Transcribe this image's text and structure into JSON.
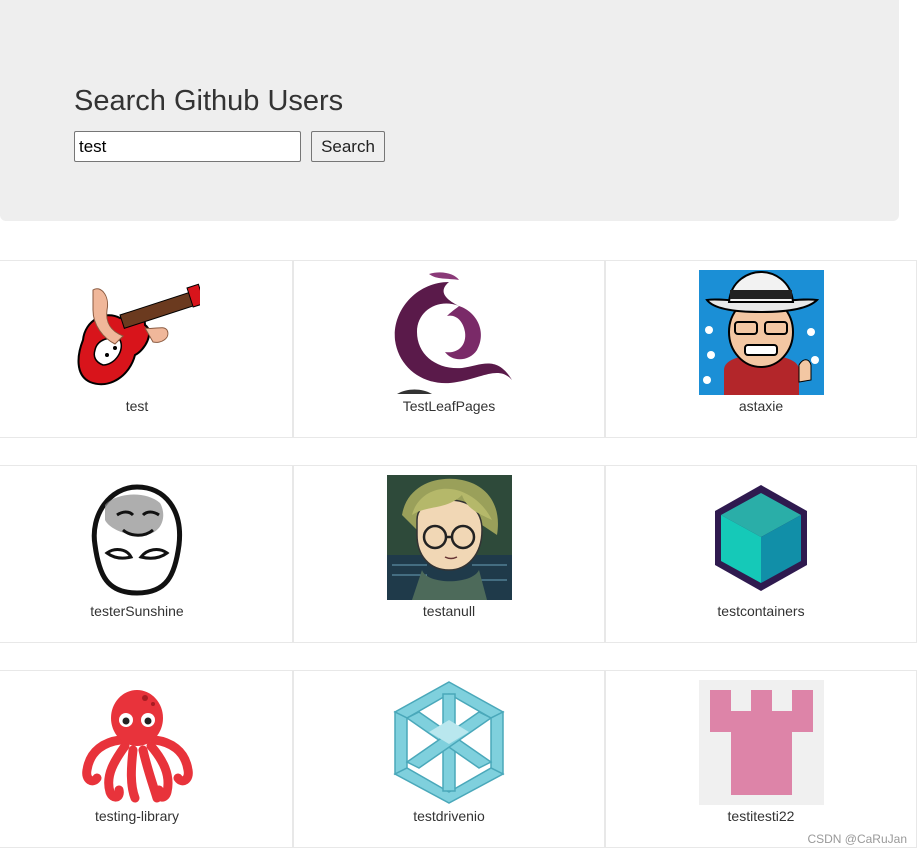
{
  "header": {
    "title": "Search Github Users",
    "search_value": "test",
    "search_button_label": "Search"
  },
  "users": [
    {
      "login": "test",
      "avatar_icon": "guitar-avatar-icon"
    },
    {
      "login": "TestLeafPages",
      "avatar_icon": "swirl-logo-avatar-icon"
    },
    {
      "login": "astaxie",
      "avatar_icon": "cartoon-cowboy-avatar-icon"
    },
    {
      "login": "testerSunshine",
      "avatar_icon": "meme-face-avatar-icon"
    },
    {
      "login": "testanull",
      "avatar_icon": "anime-character-avatar-icon"
    },
    {
      "login": "testcontainers",
      "avatar_icon": "teal-cube-avatar-icon"
    },
    {
      "login": "testing-library",
      "avatar_icon": "red-octopus-avatar-icon"
    },
    {
      "login": "testdrivenio",
      "avatar_icon": "impossible-cube-avatar-icon"
    },
    {
      "login": "testitesti22",
      "avatar_icon": "pink-identicon-avatar-icon"
    }
  ],
  "watermark": "CSDN @CaRuJan",
  "colors": {
    "jumbotron_bg": "#eeeeee",
    "card_border": "#e8e8e8",
    "text": "#333333"
  }
}
